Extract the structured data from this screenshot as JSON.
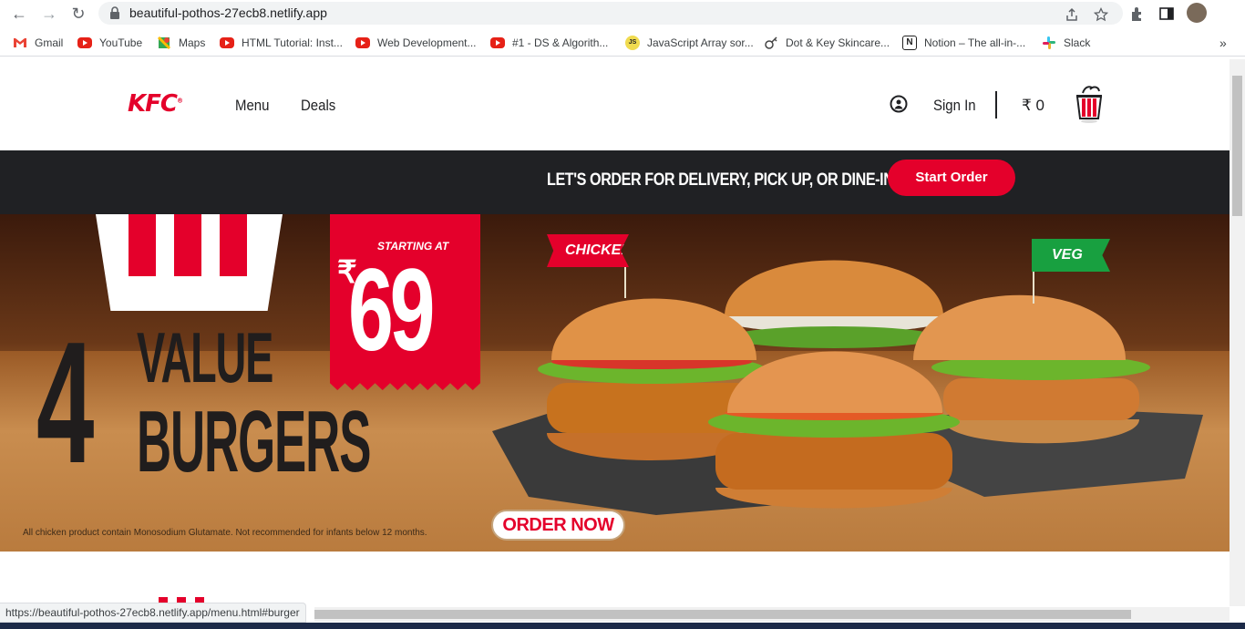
{
  "browser": {
    "url": "beautiful-pothos-27ecb8.netlify.app",
    "status_url": "https://beautiful-pothos-27ecb8.netlify.app/menu.html#burger",
    "bookmarks": [
      {
        "label": "Gmail",
        "icon": "gmail-icon"
      },
      {
        "label": "YouTube",
        "icon": "youtube-icon"
      },
      {
        "label": "Maps",
        "icon": "maps-icon"
      },
      {
        "label": "HTML Tutorial: Inst...",
        "icon": "youtube-icon"
      },
      {
        "label": "Web Development...",
        "icon": "youtube-icon"
      },
      {
        "label": "#1 - DS & Algorith...",
        "icon": "youtube-icon"
      },
      {
        "label": "JavaScript Array sor...",
        "icon": "js-icon"
      },
      {
        "label": "Dot & Key Skincare...",
        "icon": "dot-key-icon"
      },
      {
        "label": "Notion – The all-in-...",
        "icon": "notion-icon"
      },
      {
        "label": "Slack",
        "icon": "slack-icon"
      }
    ],
    "more_bookmarks": "»"
  },
  "header": {
    "logo": "KFC",
    "nav": [
      "Menu",
      "Deals"
    ],
    "sign_in": "Sign In",
    "cart_total": "₹ 0"
  },
  "banner": {
    "text": "LET'S ORDER FOR DELIVERY, PICK UP, OR DINE-IN",
    "start_button": "Start Order"
  },
  "hero": {
    "number": "4",
    "headline_1": "VALUE",
    "headline_2": "BURGERS",
    "starting_at": "STARTING AT",
    "currency": "₹",
    "price": "69",
    "flag_chicken": "CHICKEN",
    "flag_veg": "VEG",
    "cta": "ORDER NOW",
    "disclaimer": "All chicken product contain Monosodium Glutamate. Not recommended for infants below 12 months."
  },
  "colors": {
    "brand_red": "#e4002b",
    "dark_banner": "#202124",
    "veg_green": "#18a040"
  }
}
